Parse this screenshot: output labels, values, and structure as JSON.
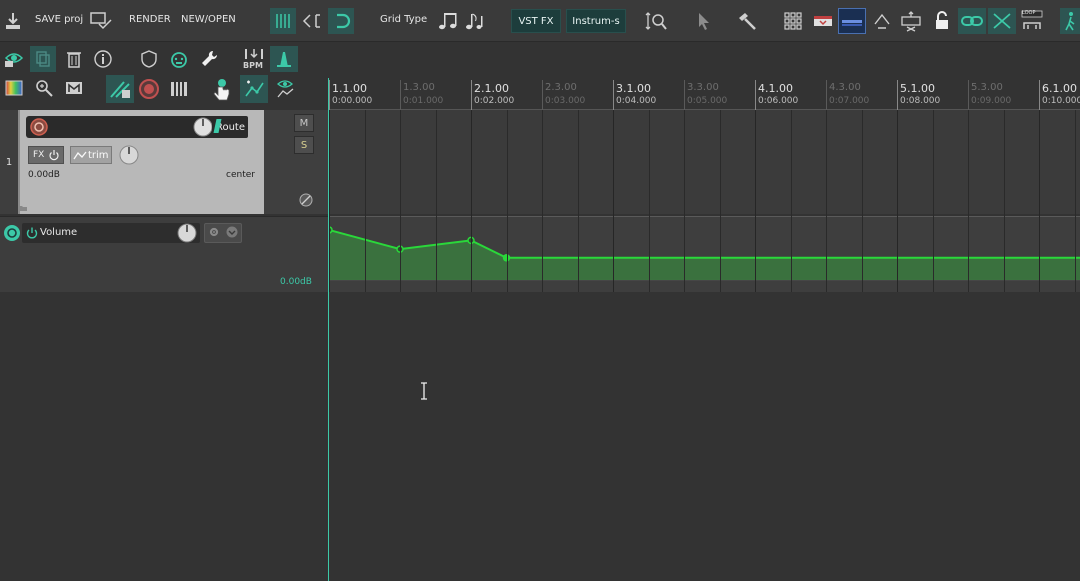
{
  "toolbar": {
    "save_label": "SAVE proj",
    "render_label": "RENDER",
    "newopen_label": "NEW/OPEN",
    "grid_type_label": "Grid Type",
    "vstfx_label": "VST FX",
    "instrum_label": "Instrum-s",
    "loop_label": "LOOP",
    "bpm_label": "BPM"
  },
  "ruler": {
    "bars": [
      {
        "label": "1.1.00",
        "time": "0:00.000"
      },
      {
        "label": "2.1.00",
        "time": "0:02.000"
      },
      {
        "label": "3.1.00",
        "time": "0:04.000"
      },
      {
        "label": "4.1.00",
        "time": "0:06.000"
      },
      {
        "label": "5.1.00",
        "time": "0:08.000"
      },
      {
        "label": "6.1.00",
        "time": "0:10.000"
      }
    ],
    "beats": [
      {
        "label": "1.3.00",
        "time": "0:01.000"
      },
      {
        "label": "2.3.00",
        "time": "0:03.000"
      },
      {
        "label": "3.3.00",
        "time": "0:05.000"
      },
      {
        "label": "4.3.00",
        "time": "0:07.000"
      },
      {
        "label": "5.3.00",
        "time": "0:09.000"
      }
    ]
  },
  "track": {
    "number": "1",
    "route_label": "Route",
    "fx_label": "FX",
    "trim_label": "trim",
    "volume": "0.00dB",
    "pan": "center",
    "mute_label": "M",
    "solo_label": "S"
  },
  "envelope": {
    "name": "Volume",
    "value": "0.00dB",
    "color": "#2ad83a",
    "fill_color": "#3a7a3e",
    "points": [
      {
        "time_s": 0.0,
        "level": 0.88
      },
      {
        "time_s": 1.0,
        "level": 0.55
      },
      {
        "time_s": 2.0,
        "level": 0.7
      },
      {
        "time_s": 2.5,
        "level": 0.4
      },
      {
        "time_s": 10.6,
        "level": 0.4
      }
    ]
  },
  "colors": {
    "accent": "#3cc9a8",
    "record": "#c05050",
    "toolbar_bg": "#3a3a3a",
    "track_panel": "#b8b8b8"
  }
}
